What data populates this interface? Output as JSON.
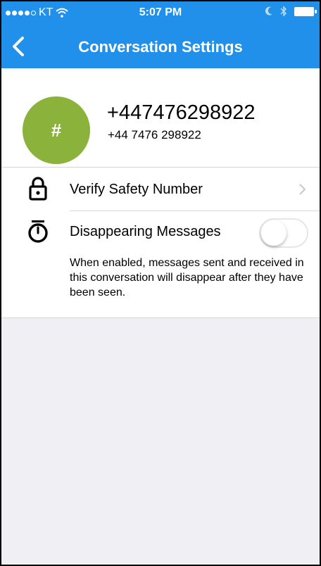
{
  "status_bar": {
    "carrier": "KT",
    "time": "5:07 PM"
  },
  "nav": {
    "title": "Conversation Settings"
  },
  "contact": {
    "avatar_text": "#",
    "avatar_color": "#8bb23a",
    "number": "+447476298922",
    "formatted_number": "+44 7476 298922"
  },
  "rows": {
    "verify": {
      "label": "Verify Safety Number"
    },
    "disappearing": {
      "label": "Disappearing Messages",
      "enabled": false,
      "description": "When enabled, messages sent and received in this conversation will disappear after they have been seen."
    }
  },
  "colors": {
    "nav_bar": "#2090ea",
    "background": "#efeff4"
  }
}
